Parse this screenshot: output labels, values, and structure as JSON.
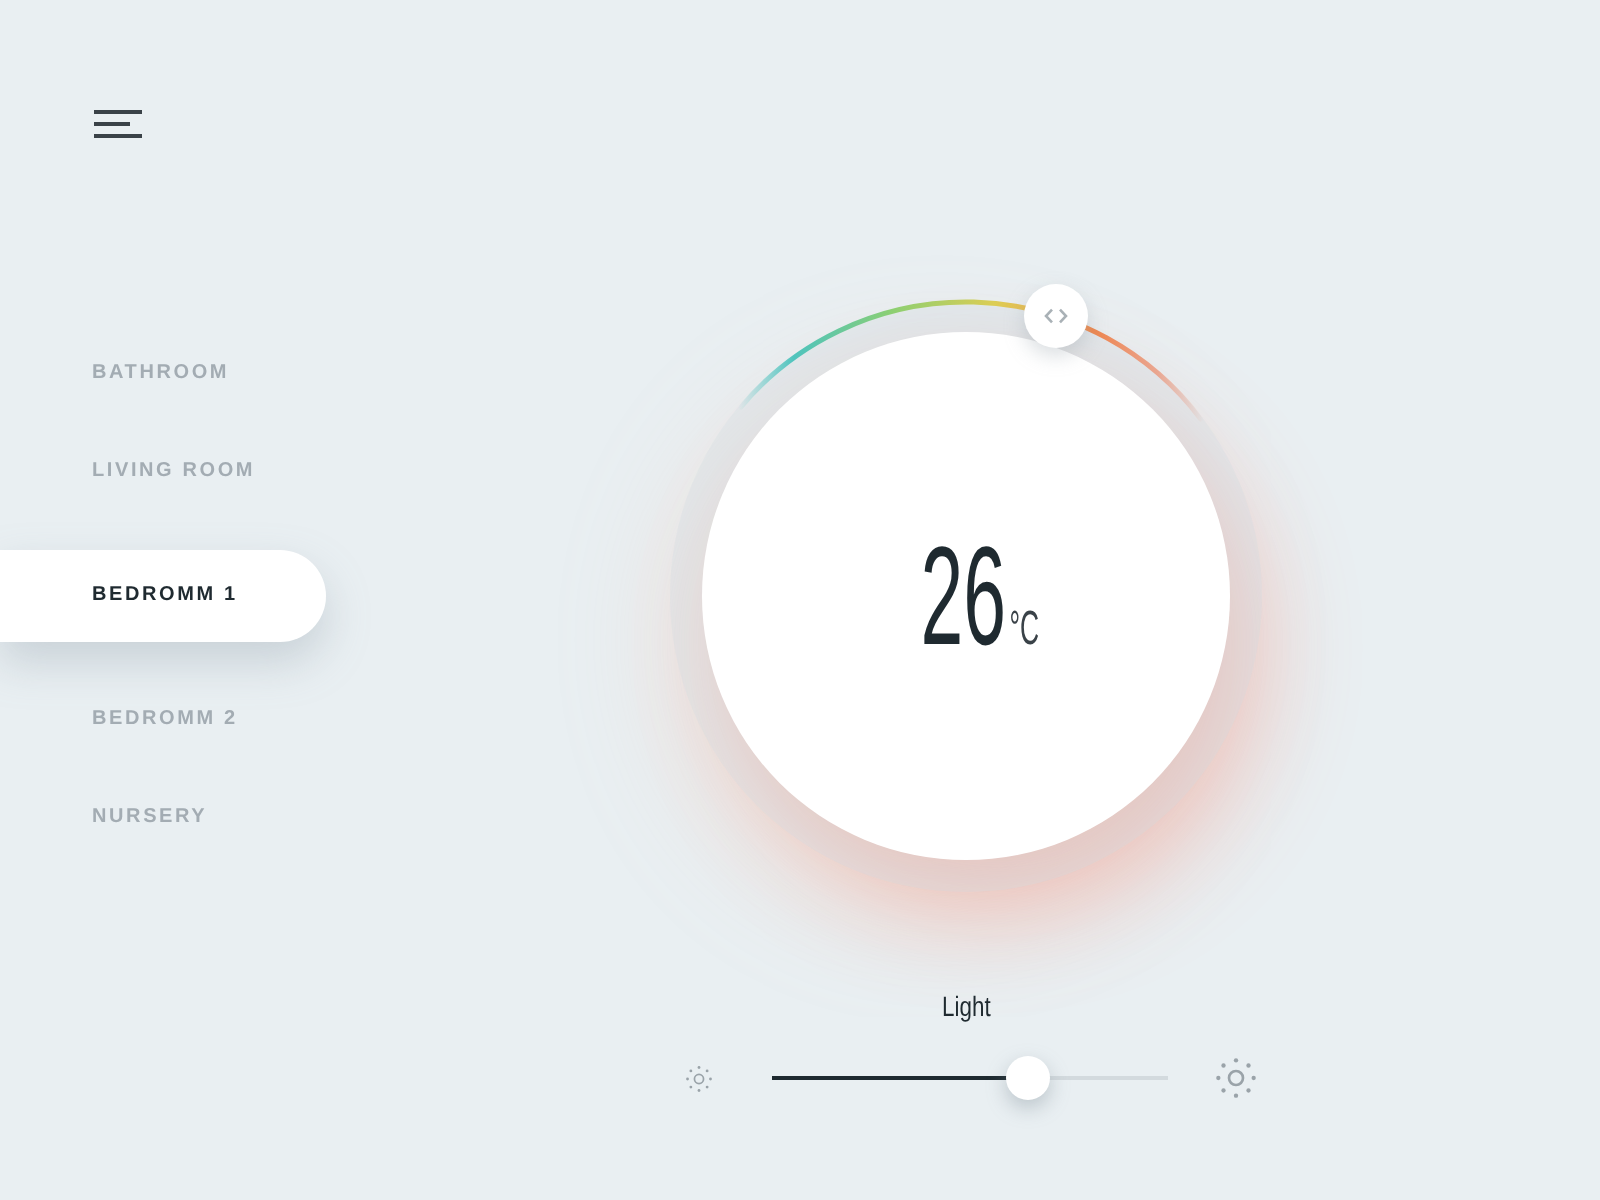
{
  "rooms": [
    {
      "label": "BATHROOM",
      "selected": false
    },
    {
      "label": "LIVING ROOM",
      "selected": false
    },
    {
      "label": "BEDROMM 1",
      "selected": true
    },
    {
      "label": "BEDROMM 2",
      "selected": false
    },
    {
      "label": "NURSERY",
      "selected": false
    }
  ],
  "dial": {
    "temperature": "26",
    "unit": "°C",
    "level": 0.66
  },
  "light": {
    "label": "Light",
    "level": 0.65
  }
}
